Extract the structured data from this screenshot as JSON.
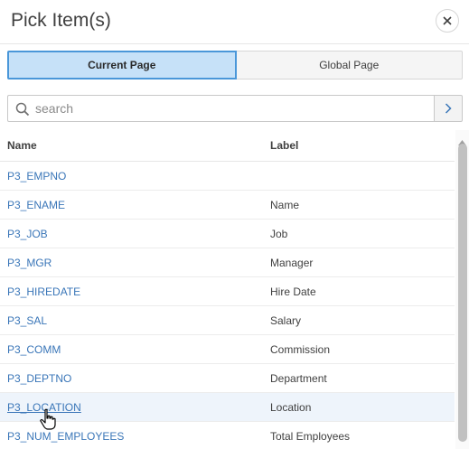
{
  "dialog": {
    "title": "Pick Item(s)",
    "close_icon": "close-icon"
  },
  "tabs": [
    {
      "label": "Current Page",
      "selected": true
    },
    {
      "label": "Global Page",
      "selected": false
    }
  ],
  "search": {
    "placeholder": "search",
    "value": "",
    "icon": "search-icon",
    "go_icon": "chevron-right-icon"
  },
  "table": {
    "columns": [
      "Name",
      "Label"
    ],
    "rows": [
      {
        "name": "P3_EMPNO",
        "label": ""
      },
      {
        "name": "P3_ENAME",
        "label": "Name"
      },
      {
        "name": "P3_JOB",
        "label": "Job"
      },
      {
        "name": "P3_MGR",
        "label": "Manager"
      },
      {
        "name": "P3_HIREDATE",
        "label": "Hire Date"
      },
      {
        "name": "P3_SAL",
        "label": "Salary"
      },
      {
        "name": "P3_COMM",
        "label": "Commission"
      },
      {
        "name": "P3_DEPTNO",
        "label": "Department"
      },
      {
        "name": "P3_LOCATION",
        "label": "Location",
        "hovered": true
      },
      {
        "name": "P3_NUM_EMPLOYEES",
        "label": "Total Employees"
      }
    ]
  },
  "colors": {
    "accent": "#4a97d9",
    "selected_tab_bg": "#c6e1f8",
    "link": "#3a76b8",
    "row_hover": "#eef4fb"
  }
}
